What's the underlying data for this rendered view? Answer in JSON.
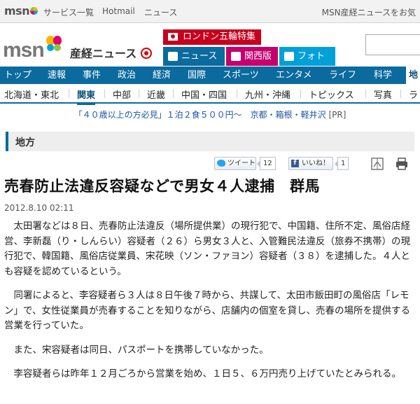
{
  "topbar": {
    "logo": "msn",
    "links": [
      "サービス一覧",
      "Hotmail",
      "ニュース"
    ],
    "right_text": "MSN産経ニュースをお気"
  },
  "header": {
    "logo_msn": "msn",
    "logo_sankei": "産経ニュース",
    "special_label": "ロンドン五輪特集",
    "tabs": [
      {
        "label": "ニュース",
        "icon": "newspaper-icon",
        "color": "#0b6a9e"
      },
      {
        "label": "関西版",
        "icon": "document-icon",
        "color": "#c4006e"
      },
      {
        "label": "フォト",
        "icon": "camera-icon",
        "color": "#00a0d8"
      }
    ]
  },
  "main_nav": [
    "トップ",
    "速報",
    "事件",
    "政治",
    "経済",
    "国際",
    "スポーツ",
    "エンタメ",
    "ライフ",
    "科学",
    "地"
  ],
  "sub_nav": [
    "北海道・東北",
    "関東",
    "中部",
    "近畿",
    "中国・四国",
    "九州・沖縄",
    "トピックス",
    "写真",
    "ラ"
  ],
  "promo": {
    "text": "「４０歳以上の方必見」１泊２食５００円～　京都・箱根・軽井沢",
    "pr": "[PR]"
  },
  "section_title": "地方",
  "share": {
    "tweet_label": "ツイート",
    "tweet_count": "12",
    "like_label": "いいね！",
    "like_count": "1"
  },
  "article": {
    "headline": "売春防止法違反容疑などで男女４人逮捕　群馬",
    "date": "2012.8.10 02:11",
    "paragraphs": [
      "太田署などは８日、売春防止法違反（場所提供業）の現行犯で、中国籍、住所不定、風俗店経営、李新磊（り・しんらい）容疑者（２６）ら男女３人と、入管難民法違反（旅券不携帯）の現行犯で、韓国籍、風俗店従業員、宋花映（ソン・ファヨン）容疑者（３８）を逮捕した。４人とも容疑を認めているという。",
      "同署によると、李容疑者ら３人は８日午後７時から、共謀して、太田市飯田町の風俗店「レモン」で、女性従業員が売春することを知りながら、店舗内の個室を貸し、売春の場所を提供する営業を行っていた。",
      "また、宋容疑者は同日、パスポートを携帯していなかった。",
      "李容疑者らは昨年１２月ごろから営業を始め、１日５、６万円売り上げていたとみられる。"
    ]
  },
  "colors": {
    "nav_blue": "#0b6a9e",
    "special_red": "#c8001e",
    "kansai_magenta": "#c4006e",
    "photo_cyan": "#00a0d8"
  }
}
